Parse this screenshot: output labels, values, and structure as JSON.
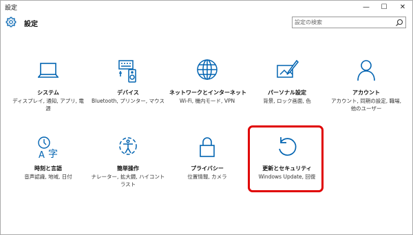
{
  "window": {
    "title": "設定",
    "minimize_glyph": "—",
    "maximize_glyph": "☐",
    "close_glyph": "✕"
  },
  "header": {
    "heading": "設定",
    "icon": "gear-icon"
  },
  "search": {
    "placeholder": "設定の検索",
    "value": "",
    "icon": "search-icon"
  },
  "colors": {
    "accent": "#0063b1",
    "highlight": "#e00000"
  },
  "tiles": [
    {
      "id": "system",
      "icon": "laptop-icon",
      "label": "システム",
      "desc": "ディスプレイ, 通知, アプリ, 電源"
    },
    {
      "id": "devices",
      "icon": "devices-icon",
      "label": "デバイス",
      "desc": "Bluetooth, プリンター, マウス"
    },
    {
      "id": "network",
      "icon": "globe-icon",
      "label": "ネットワークとインターネット",
      "desc": "Wi-Fi, 機内モード, VPN"
    },
    {
      "id": "personalization",
      "icon": "personalization-icon",
      "label": "パーソナル設定",
      "desc": "背景, ロック画面, 色"
    },
    {
      "id": "accounts",
      "icon": "person-icon",
      "label": "アカウント",
      "desc": "アカウント, 同期の設定, 職場, 他のユーザー"
    },
    {
      "id": "time-language",
      "icon": "time-language-icon",
      "label": "時刻と言語",
      "desc": "音声認識, 地域, 日付"
    },
    {
      "id": "ease-of-access",
      "icon": "ease-of-access-icon",
      "label": "簡単操作",
      "desc": "ナレーター, 拡大鏡, ハイコントラスト"
    },
    {
      "id": "privacy",
      "icon": "lock-icon",
      "label": "プライバシー",
      "desc": "位置情報, カメラ"
    },
    {
      "id": "update-security",
      "icon": "refresh-icon",
      "label": "更新とセキュリティ",
      "desc": "Windows Update, 回復"
    }
  ]
}
